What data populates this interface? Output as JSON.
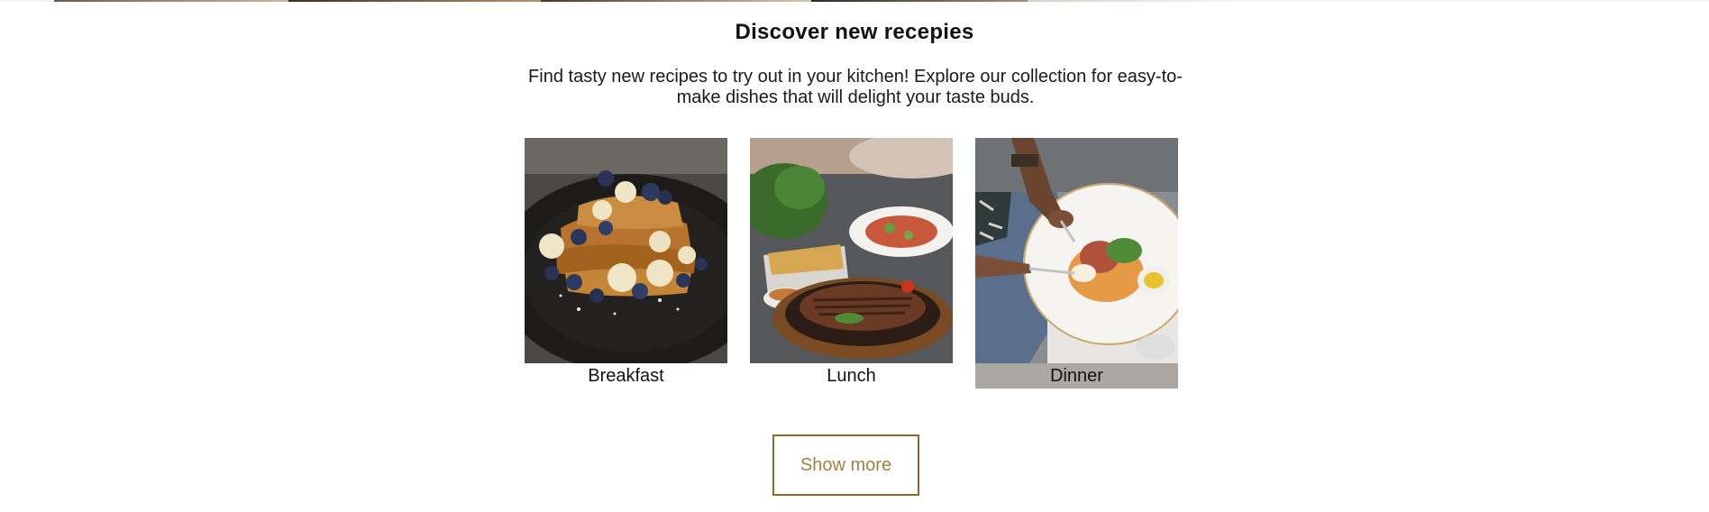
{
  "section": {
    "title": "Discover new recepies",
    "description": "Find tasty new recipes to try out in your kitchen! Explore our collection for easy-to-make dishes that will delight your taste buds."
  },
  "categories": [
    {
      "label": "Breakfast",
      "image": "french-toast-with-bananas-and-blueberries-photo",
      "active": false
    },
    {
      "label": "Lunch",
      "image": "grilled-steak-with-salad-and-fries-photo",
      "active": false
    },
    {
      "label": "Dinner",
      "image": "person-cutting-plated-meal-photo",
      "active": true
    }
  ],
  "actions": {
    "show_more_label": "Show more"
  },
  "colors": {
    "button_border": "#8b6a2b",
    "button_text": "#a0813f",
    "active_label_bg": "#aba7a4"
  }
}
